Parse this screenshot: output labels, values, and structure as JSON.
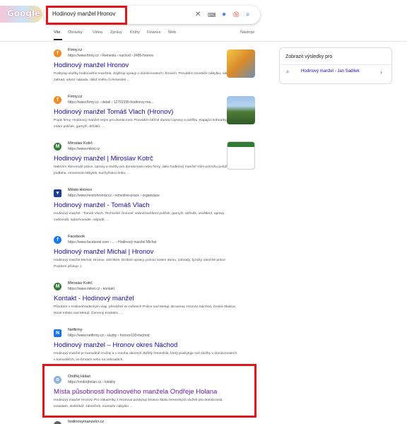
{
  "search": {
    "query": "Hodinový manžel Hronov"
  },
  "logo": "Google",
  "tabs": [
    "Vše",
    "Obrázky",
    "Videa",
    "Zprávy",
    "Knihy",
    "Finance",
    "Web"
  ],
  "tools_label": "Nástroje",
  "sidebar": {
    "title": "Zobrazit výsledky pro",
    "link": "Hodinový manžel - Jan Sadílek"
  },
  "results": [
    {
      "site": "Firmy.cz",
      "url": "https://www.firmy.cz › Remesla › nachod › 2485-hronov",
      "title": "Hodinový manžel Hronov",
      "snippet": "Poskytuji služby hodinového manžela. Zajišťuji opravy v domácnostech i firmách. Provádím montáže nábytku, údržbu zahrad, odvoz odpadu, úklid sněhu či řemeslné ..."
    },
    {
      "site": "Firmy.cz",
      "url": "https://www.firmy.cz › detail › 12791395-hodinovy-ma...",
      "title": "Hodinový manžel Tomáš Vlach (Hronov)",
      "snippet": "Popis firmy. Hodinový manžel nejen pro domácnost. Provádím běžné domácí opravy a údržbu. Kapající kohoutky, sifony, vrtání poliček, garnyží, držáků, ..."
    },
    {
      "site": "Miroslav Kotrč",
      "url": "https://www.mikot.cz",
      "title": "Hodinový manžel | Miroslav Kotrč",
      "snippet": "Nabízím různorodé práce, opravy a služby pro domácnosti nebo firmy. Jako hodinový manžel Vám pomohu položit podlahu, smontovat nábytek, kuchyňskou linku, ..."
    },
    {
      "site": "Město Hronov",
      "url": "https://www.mestohronov.cz › remeslne-prace › organizace",
      "title": "Hodinový manžel - Tomáš Vlach",
      "snippet": "Hodinový manžel - Tomáš Vlach. Technické činnosti: vrtání/zavěšení poliček, garnyží, skříněk, osvětlení, opravy vodovodů, splachovadel, odpadů, ..."
    },
    {
      "site": "Facebook",
      "url": "https://www.facebook.com › ... › Hodinový manžel Michal",
      "title": "Hodinový manžel Michal | Hronov",
      "snippet": "Hodinový manžel Michal, Hronov. 108 likes. Drobné opravy, pomoc kolem domu, zahrady, fyzicky náročné práce. Pozitivní přístup :)"
    },
    {
      "site": "Miroslav Kotrč",
      "url": "https://www.mikot.cz › kontakt",
      "title": "Kontakt - Hodinový manžel",
      "snippet": "Působím v Královehradeckým kraji, převážně ve městech Police nad Metují, Broumov, Hronov, Náchod, Česká Skalice, Nové město nad Metují, Červený Kostelec, ..."
    },
    {
      "site": "Netfirmy",
      "url": "https://www.netfirmy.cz › sluzby › hronov103-nachod",
      "title": "Hodinový manžel – Hronov okres Náchod",
      "snippet": "Hodinový manžel je manuálně zručný a v mnoha oborech zběhlý řemeslník, který poskytuje své služby v domácnostech, v kancelářích, ve firmách nebo na zahradách."
    },
    {
      "site": "Ondřej Holan",
      "url": "https://ondrejholan.cz › lokality",
      "title": "Místa působnosti hodinového manžela Ondřeje Holana",
      "snippet": "Hodinový manžel Hronov. Pro zákazníky z Hronova poskytuji širokou škálu řemeslných služeb pro domácnosti. Instalatér, elektrikář, zámečník, montáže nábytku ..."
    },
    {
      "site": "hodinovymanzelcr.cz"
    }
  ]
}
